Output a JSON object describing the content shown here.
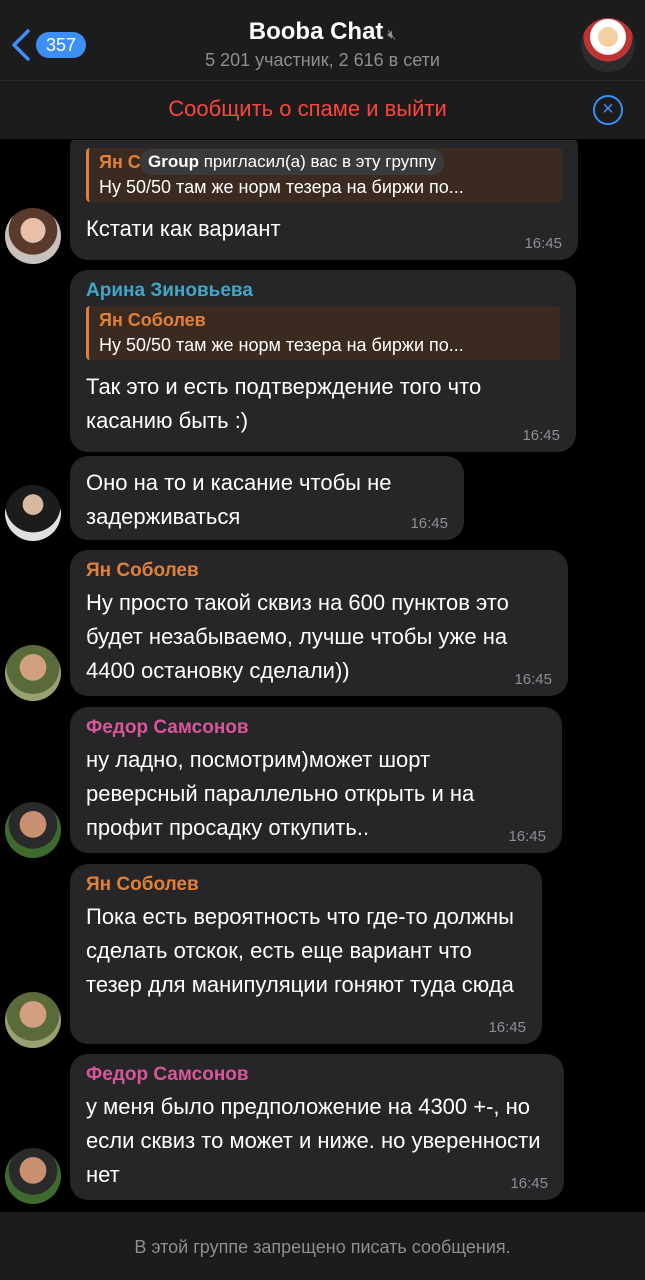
{
  "header": {
    "back_count": "357",
    "title": "Booba Chat",
    "subtitle": "5 201 участник, 2 616 в сети"
  },
  "spam_bar": {
    "label": "Сообщить о спаме и выйти"
  },
  "service_pill": {
    "name": "Group",
    "text": " пригласил(а) вас в эту группу"
  },
  "messages": [
    {
      "sender": "",
      "reply_name": "Ян С",
      "reply_text": "Ну 50/50 там же норм тезера на биржи по...",
      "text": "Кстати как вариант",
      "time": "16:45"
    },
    {
      "sender": "Арина Зиновьева",
      "reply_name": "Ян Соболев",
      "reply_text": "Ну 50/50 там же норм тезера на биржи по...",
      "text": "Так это и есть подтверждение того что касанию быть :)",
      "time": "16:45"
    },
    {
      "sender": "",
      "text": "Оно на то и касание чтобы не задерживаться",
      "time": "16:45"
    },
    {
      "sender": "Ян Соболев",
      "text": "Ну просто такой сквиз на 600 пунктов это будет незабываемо, лучше чтобы уже на 4400 остановку сделали))",
      "time": "16:45"
    },
    {
      "sender": "Федор Самсонов",
      "text": "ну ладно, посмотрим)может шорт реверсный параллельно открыть и на профит просадку откупить..",
      "time": "16:45"
    },
    {
      "sender": "Ян Соболев",
      "text": "Пока есть вероятность что где-то должны сделать отскок, есть еще вариант что тезер для манипуляции гоняют туда сюда",
      "time": "16:45"
    },
    {
      "sender": "Федор Самсонов",
      "text": "у меня было предположение на 4300 +-, но если сквиз то может и ниже. но уверенности нет",
      "time": "16:45"
    }
  ],
  "footer": {
    "label": "В этой группе запрещено писать сообщения."
  },
  "colors": {
    "accent": "#3d8ef7",
    "spam": "#ff453a",
    "bubble": "#262628"
  }
}
